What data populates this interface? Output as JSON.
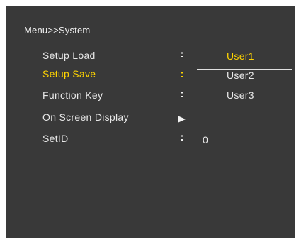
{
  "menu": {
    "breadcrumb": "Menu>>System",
    "items": [
      {
        "label": "Setup Load",
        "indicator": "colon"
      },
      {
        "label": "Setup Save",
        "indicator": "colon",
        "selected": true
      },
      {
        "label": "Function Key",
        "indicator": "colon"
      },
      {
        "label": "On Screen Display",
        "indicator": "arrow"
      },
      {
        "label": "SetID",
        "indicator": "colon",
        "value": "0"
      }
    ],
    "colon_glyph": ":",
    "submenu_options": [
      {
        "label": "User1",
        "selected": true
      },
      {
        "label": "User2"
      },
      {
        "label": "User3"
      }
    ]
  },
  "colors": {
    "panel_background": "#393939",
    "text": "#e8e8e8",
    "highlight": "#ffd400"
  },
  "icons": {
    "submenu_indicator": "play-arrow-icon"
  }
}
